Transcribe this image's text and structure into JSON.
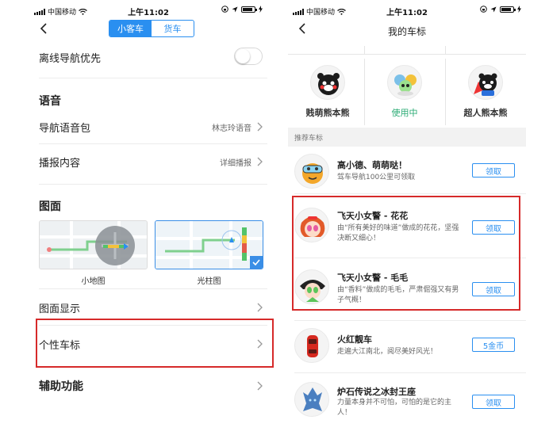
{
  "left": {
    "status": {
      "carrier": "中国移动",
      "time": "上午11:02"
    },
    "tabs": [
      {
        "label": "小客车",
        "active": true
      },
      {
        "label": "货车",
        "active": false
      }
    ],
    "offline_nav": {
      "label": "离线导航优先",
      "on": false
    },
    "voice_section": "语音",
    "voice_pack": {
      "label": "导航语音包",
      "value": "林志玲语音"
    },
    "broadcast": {
      "label": "播报内容",
      "value": "详细播报"
    },
    "map_section": "图面",
    "map_modes": [
      {
        "label": "小地图",
        "selected": false
      },
      {
        "label": "光柱图",
        "selected": true
      }
    ],
    "map_display": {
      "label": "图面显示"
    },
    "car_logo": {
      "label": "个性车标"
    },
    "assist": "辅助功能"
  },
  "right": {
    "status": {
      "carrier": "中国移动",
      "time": "上午11:02"
    },
    "title": "我的车标",
    "owned": [
      {
        "label": "贱萌熊本熊",
        "using": false,
        "icon": "kumamon-icon"
      },
      {
        "label": "使用中",
        "using": true,
        "icon": "powerpuff-icon"
      },
      {
        "label": "超人熊本熊",
        "using": false,
        "icon": "super-kumamon-icon"
      }
    ],
    "recommend_label": "推荐车标",
    "items": [
      {
        "title": "高小德、萌萌哒！",
        "desc": "驾车导航100公里可领取",
        "button": "领取",
        "icon": "goggle-bird-icon"
      },
      {
        "title": "飞天小女警 - 花花",
        "desc": "由“所有美好的味道”做成的花花，坚强决断又细心！",
        "button": "领取",
        "icon": "blossom-icon"
      },
      {
        "title": "飞天小女警 - 毛毛",
        "desc": "由“香料”做成的毛毛，严肃倔强又有男子气概！",
        "button": "领取",
        "icon": "buttercup-icon"
      },
      {
        "title": "火红靓车",
        "desc": "走遍大江南北，阅尽美好风光！",
        "button": "5金币",
        "icon": "red-car-icon"
      },
      {
        "title": "炉石传说之冰封王座",
        "desc": "力量本身并不可怕，可怕的是它的主人！",
        "button": "领取",
        "icon": "lich-king-icon"
      }
    ]
  },
  "colors": {
    "accent": "#2a8ff0",
    "highlight": "#d62a2a",
    "using": "#2aab74"
  }
}
